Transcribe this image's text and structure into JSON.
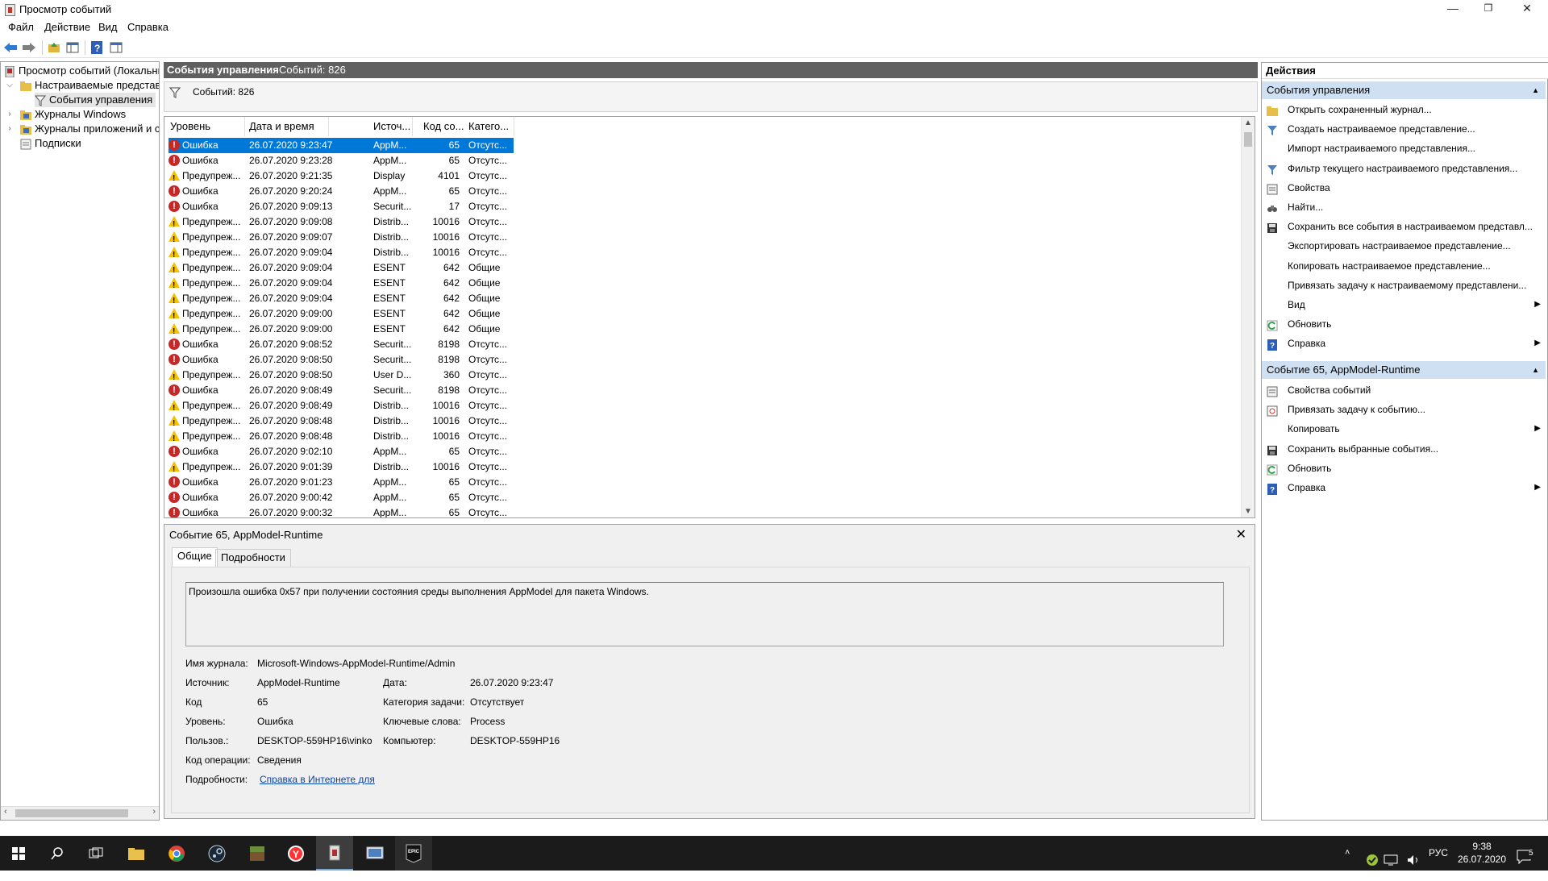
{
  "window": {
    "title": "Просмотр событий",
    "minimize": "—",
    "restore": "❐",
    "close": "✕"
  },
  "menu": {
    "file": "Файл",
    "action": "Действие",
    "view": "Вид",
    "help": "Справка"
  },
  "tree": {
    "root": "Просмотр событий (Локальный)",
    "custom_views": "Настраиваемые представления",
    "admin_events": "События управления",
    "windows_logs": "Журналы Windows",
    "app_logs": "Журналы приложений и служб",
    "subscriptions": "Подписки"
  },
  "panel": {
    "title": "События управления",
    "count_label": "Событий: 826",
    "filter_count": "Событий: 826"
  },
  "columns": {
    "level": "Уровень",
    "datetime": "Дата и время",
    "source": "Источ...",
    "code": "Код со...",
    "category": "Катего..."
  },
  "events": [
    {
      "level": "error",
      "level_text": "Ошибка",
      "datetime": "26.07.2020 9:23:47",
      "source": "AppM...",
      "code": "65",
      "category": "Отсутс..."
    },
    {
      "level": "error",
      "level_text": "Ошибка",
      "datetime": "26.07.2020 9:23:28",
      "source": "AppM...",
      "code": "65",
      "category": "Отсутс..."
    },
    {
      "level": "warn",
      "level_text": "Предупреж...",
      "datetime": "26.07.2020 9:21:35",
      "source": "Display",
      "code": "4101",
      "category": "Отсутс..."
    },
    {
      "level": "error",
      "level_text": "Ошибка",
      "datetime": "26.07.2020 9:20:24",
      "source": "AppM...",
      "code": "65",
      "category": "Отсутс..."
    },
    {
      "level": "error",
      "level_text": "Ошибка",
      "datetime": "26.07.2020 9:09:13",
      "source": "Securit...",
      "code": "17",
      "category": "Отсутс..."
    },
    {
      "level": "warn",
      "level_text": "Предупреж...",
      "datetime": "26.07.2020 9:09:08",
      "source": "Distrib...",
      "code": "10016",
      "category": "Отсутс..."
    },
    {
      "level": "warn",
      "level_text": "Предупреж...",
      "datetime": "26.07.2020 9:09:07",
      "source": "Distrib...",
      "code": "10016",
      "category": "Отсутс..."
    },
    {
      "level": "warn",
      "level_text": "Предупреж...",
      "datetime": "26.07.2020 9:09:04",
      "source": "Distrib...",
      "code": "10016",
      "category": "Отсутс..."
    },
    {
      "level": "warn",
      "level_text": "Предупреж...",
      "datetime": "26.07.2020 9:09:04",
      "source": "ESENT",
      "code": "642",
      "category": "Общие"
    },
    {
      "level": "warn",
      "level_text": "Предупреж...",
      "datetime": "26.07.2020 9:09:04",
      "source": "ESENT",
      "code": "642",
      "category": "Общие"
    },
    {
      "level": "warn",
      "level_text": "Предупреж...",
      "datetime": "26.07.2020 9:09:04",
      "source": "ESENT",
      "code": "642",
      "category": "Общие"
    },
    {
      "level": "warn",
      "level_text": "Предупреж...",
      "datetime": "26.07.2020 9:09:00",
      "source": "ESENT",
      "code": "642",
      "category": "Общие"
    },
    {
      "level": "warn",
      "level_text": "Предупреж...",
      "datetime": "26.07.2020 9:09:00",
      "source": "ESENT",
      "code": "642",
      "category": "Общие"
    },
    {
      "level": "error",
      "level_text": "Ошибка",
      "datetime": "26.07.2020 9:08:52",
      "source": "Securit...",
      "code": "8198",
      "category": "Отсутс..."
    },
    {
      "level": "error",
      "level_text": "Ошибка",
      "datetime": "26.07.2020 9:08:50",
      "source": "Securit...",
      "code": "8198",
      "category": "Отсутс..."
    },
    {
      "level": "warn",
      "level_text": "Предупреж...",
      "datetime": "26.07.2020 9:08:50",
      "source": "User D...",
      "code": "360",
      "category": "Отсутс..."
    },
    {
      "level": "error",
      "level_text": "Ошибка",
      "datetime": "26.07.2020 9:08:49",
      "source": "Securit...",
      "code": "8198",
      "category": "Отсутс..."
    },
    {
      "level": "warn",
      "level_text": "Предупреж...",
      "datetime": "26.07.2020 9:08:49",
      "source": "Distrib...",
      "code": "10016",
      "category": "Отсутс..."
    },
    {
      "level": "warn",
      "level_text": "Предупреж...",
      "datetime": "26.07.2020 9:08:48",
      "source": "Distrib...",
      "code": "10016",
      "category": "Отсутс..."
    },
    {
      "level": "warn",
      "level_text": "Предупреж...",
      "datetime": "26.07.2020 9:08:48",
      "source": "Distrib...",
      "code": "10016",
      "category": "Отсутс..."
    },
    {
      "level": "error",
      "level_text": "Ошибка",
      "datetime": "26.07.2020 9:02:10",
      "source": "AppM...",
      "code": "65",
      "category": "Отсутс..."
    },
    {
      "level": "warn",
      "level_text": "Предупреж...",
      "datetime": "26.07.2020 9:01:39",
      "source": "Distrib...",
      "code": "10016",
      "category": "Отсутс..."
    },
    {
      "level": "error",
      "level_text": "Ошибка",
      "datetime": "26.07.2020 9:01:23",
      "source": "AppM...",
      "code": "65",
      "category": "Отсутс..."
    },
    {
      "level": "error",
      "level_text": "Ошибка",
      "datetime": "26.07.2020 9:00:42",
      "source": "AppM...",
      "code": "65",
      "category": "Отсутс..."
    },
    {
      "level": "error",
      "level_text": "Ошибка",
      "datetime": "26.07.2020 9:00:32",
      "source": "AppM...",
      "code": "65",
      "category": "Отсутс..."
    }
  ],
  "detail": {
    "title": "Событие 65, AppModel-Runtime",
    "close": "✕",
    "tab_general": "Общие",
    "tab_details": "Подробности",
    "message": "Произошла ошибка 0x57 при получении состояния среды выполнения AppModel для пакета Windows.",
    "log_name_label": "Имя журнала:",
    "log_name": "Microsoft-Windows-AppModel-Runtime/Admin",
    "source_label": "Источник:",
    "source": "AppModel-Runtime",
    "date_label": "Дата:",
    "date": "26.07.2020 9:23:47",
    "code_label": "Код",
    "code": "65",
    "task_label": "Категория задачи:",
    "task": "Отсутствует",
    "level_label": "Уровень:",
    "level": "Ошибка",
    "keywords_label": "Ключевые слова:",
    "keywords": "Process",
    "user_label": "Пользов.:",
    "user": "DESKTOP-559HP16\\vinko",
    "computer_label": "Компьютер:",
    "computer": "DESKTOP-559HP16",
    "opcode_label": "Код операции:",
    "opcode": "Сведения",
    "more_label": "Подробности:",
    "more_link": "Справка в Интернете для"
  },
  "actions": {
    "header": "Действия",
    "section1": "События управления",
    "items1": [
      {
        "label": "Открыть сохраненный журнал...",
        "icon": "folder-icon"
      },
      {
        "label": "Создать настраиваемое представление...",
        "icon": "filter-icon"
      },
      {
        "label": "Импорт настраиваемого представления...",
        "icon": ""
      },
      {
        "label": "Фильтр текущего настраиваемого представления...",
        "icon": "filter-icon"
      },
      {
        "label": "Свойства",
        "icon": "properties-icon"
      },
      {
        "label": "Найти...",
        "icon": "find-icon"
      },
      {
        "label": "Сохранить все события в настраиваемом представл...",
        "icon": "save-icon"
      },
      {
        "label": "Экспортировать настраиваемое представление...",
        "icon": ""
      },
      {
        "label": "Копировать настраиваемое представление...",
        "icon": ""
      },
      {
        "label": "Привязать задачу к настраиваемому представлени...",
        "icon": ""
      },
      {
        "label": "Вид",
        "icon": "",
        "sub": "▶"
      },
      {
        "label": "Обновить",
        "icon": "refresh-icon"
      },
      {
        "label": "Справка",
        "icon": "help-icon",
        "sub": "▶"
      }
    ],
    "section2": "Событие 65, AppModel-Runtime",
    "items2": [
      {
        "label": "Свойства событий",
        "icon": "properties-icon"
      },
      {
        "label": "Привязать задачу к событию...",
        "icon": "task-icon"
      },
      {
        "label": "Копировать",
        "icon": "copy-icon",
        "sub": "▶"
      },
      {
        "label": "Сохранить выбранные события...",
        "icon": "save-icon"
      },
      {
        "label": "Обновить",
        "icon": "refresh-icon"
      },
      {
        "label": "Справка",
        "icon": "help-icon",
        "sub": "▶"
      }
    ]
  },
  "taskbar": {
    "lang": "РУС",
    "time": "9:38",
    "date": "26.07.2020",
    "notif_count": "5"
  }
}
